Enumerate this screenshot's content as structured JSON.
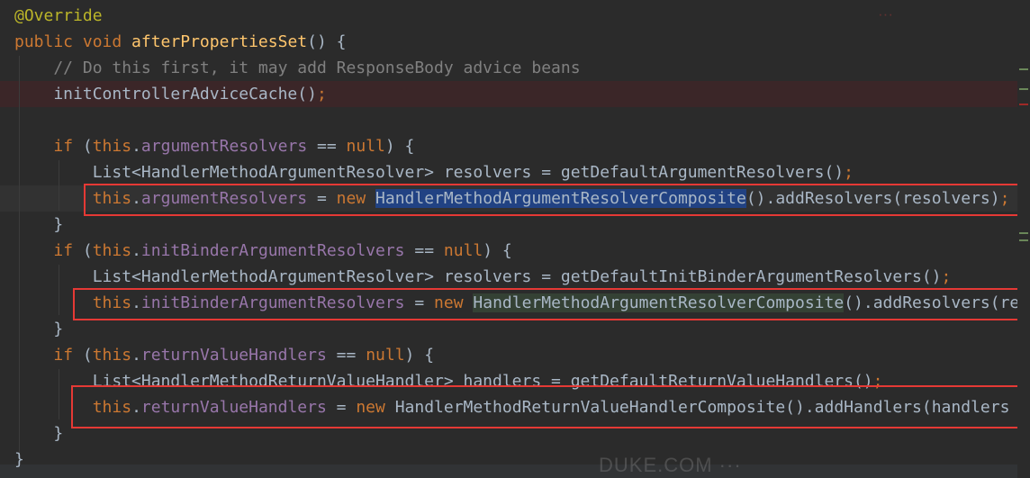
{
  "code_lines": [
    {
      "segments": [
        {
          "text": "@Override",
          "cls": "ann"
        }
      ]
    },
    {
      "segments": [
        {
          "text": "public ",
          "cls": "kw"
        },
        {
          "text": "void ",
          "cls": "kw"
        },
        {
          "text": "afterPropertiesSet",
          "cls": "fn"
        },
        {
          "text": "() {",
          "cls": ""
        }
      ]
    },
    {
      "segments": [
        {
          "text": "    // Do this first, it may add ResponseBody advice beans",
          "cls": "cmt"
        }
      ]
    },
    {
      "segments": [
        {
          "text": "    initControllerAdviceCache()",
          "cls": ""
        },
        {
          "text": ";",
          "cls": "kw"
        }
      ]
    },
    {
      "segments": [
        {
          "text": "",
          "cls": ""
        }
      ]
    },
    {
      "segments": [
        {
          "text": "    ",
          "cls": ""
        },
        {
          "text": "if ",
          "cls": "kw"
        },
        {
          "text": "(",
          "cls": ""
        },
        {
          "text": "this",
          "cls": "kw"
        },
        {
          "text": ".",
          "cls": ""
        },
        {
          "text": "argumentResolvers",
          "cls": "fld"
        },
        {
          "text": " == ",
          "cls": ""
        },
        {
          "text": "null",
          "cls": "kw"
        },
        {
          "text": ") {",
          "cls": ""
        }
      ]
    },
    {
      "segments": [
        {
          "text": "        List<HandlerMethodArgumentResolver> resolvers = getDefaultArgumentResolvers()",
          "cls": ""
        },
        {
          "text": ";",
          "cls": "kw"
        }
      ]
    },
    {
      "segments": [
        {
          "text": "        ",
          "cls": ""
        },
        {
          "text": "this",
          "cls": "kw"
        },
        {
          "text": ".",
          "cls": ""
        },
        {
          "text": "argumentResolvers",
          "cls": "fld"
        },
        {
          "text": " = ",
          "cls": ""
        },
        {
          "text": "new ",
          "cls": "kw"
        },
        {
          "text": "HandlerMethodArgumentResolverComposite",
          "cls": "sel-blue"
        },
        {
          "text": "().addResolvers(resolvers)",
          "cls": ""
        },
        {
          "text": ";",
          "cls": "kw"
        }
      ]
    },
    {
      "segments": [
        {
          "text": "    }",
          "cls": ""
        }
      ]
    },
    {
      "segments": [
        {
          "text": "    ",
          "cls": ""
        },
        {
          "text": "if ",
          "cls": "kw"
        },
        {
          "text": "(",
          "cls": ""
        },
        {
          "text": "this",
          "cls": "kw"
        },
        {
          "text": ".",
          "cls": ""
        },
        {
          "text": "initBinderArgumentResolvers",
          "cls": "fld"
        },
        {
          "text": " == ",
          "cls": ""
        },
        {
          "text": "null",
          "cls": "kw"
        },
        {
          "text": ") {",
          "cls": ""
        }
      ]
    },
    {
      "segments": [
        {
          "text": "        List<HandlerMethodArgumentResolver> resolvers = getDefaultInitBinderArgumentResolvers()",
          "cls": ""
        },
        {
          "text": ";",
          "cls": "kw"
        }
      ]
    },
    {
      "segments": [
        {
          "text": "        ",
          "cls": ""
        },
        {
          "text": "this",
          "cls": "kw"
        },
        {
          "text": ".",
          "cls": ""
        },
        {
          "text": "initBinderArgumentResolvers",
          "cls": "fld"
        },
        {
          "text": " = ",
          "cls": ""
        },
        {
          "text": "new ",
          "cls": "kw"
        },
        {
          "text": "HandlerMethodArgumentResolverComposite",
          "cls": "sel-green"
        },
        {
          "text": "().addResolvers(re",
          "cls": ""
        }
      ]
    },
    {
      "segments": [
        {
          "text": "    }",
          "cls": ""
        }
      ]
    },
    {
      "segments": [
        {
          "text": "    ",
          "cls": ""
        },
        {
          "text": "if ",
          "cls": "kw"
        },
        {
          "text": "(",
          "cls": ""
        },
        {
          "text": "this",
          "cls": "kw"
        },
        {
          "text": ".",
          "cls": ""
        },
        {
          "text": "returnValueHandlers",
          "cls": "fld"
        },
        {
          "text": " == ",
          "cls": ""
        },
        {
          "text": "null",
          "cls": "kw"
        },
        {
          "text": ") {",
          "cls": ""
        }
      ]
    },
    {
      "segments": [
        {
          "text": "        List<HandlerMethodReturnValueHandler> handlers = getDefaultReturnValueHandlers()",
          "cls": ""
        },
        {
          "text": ";",
          "cls": "kw"
        }
      ]
    },
    {
      "segments": [
        {
          "text": "        ",
          "cls": ""
        },
        {
          "text": "this",
          "cls": "kw"
        },
        {
          "text": ".",
          "cls": ""
        },
        {
          "text": "returnValueHandlers",
          "cls": "fld"
        },
        {
          "text": " = ",
          "cls": ""
        },
        {
          "text": "new ",
          "cls": "kw"
        },
        {
          "text": "HandlerMethodReturnValueHandlerComposite().addHandlers(handlers",
          "cls": ""
        }
      ]
    },
    {
      "segments": [
        {
          "text": "    }",
          "cls": ""
        }
      ]
    },
    {
      "segments": [
        {
          "text": "}",
          "cls": ""
        }
      ]
    }
  ],
  "watermarks": {
    "top_right": "···",
    "bottom": "DUKE.COM ···"
  },
  "colors": {
    "background": "#2b2b2b",
    "keyword": "#cc7832",
    "annotation": "#bbb529",
    "method": "#ffc66d",
    "field": "#9876aa",
    "comment": "#808080",
    "highlight_box": "#e53935",
    "selection_blue": "#214283",
    "selection_green": "#344134"
  }
}
